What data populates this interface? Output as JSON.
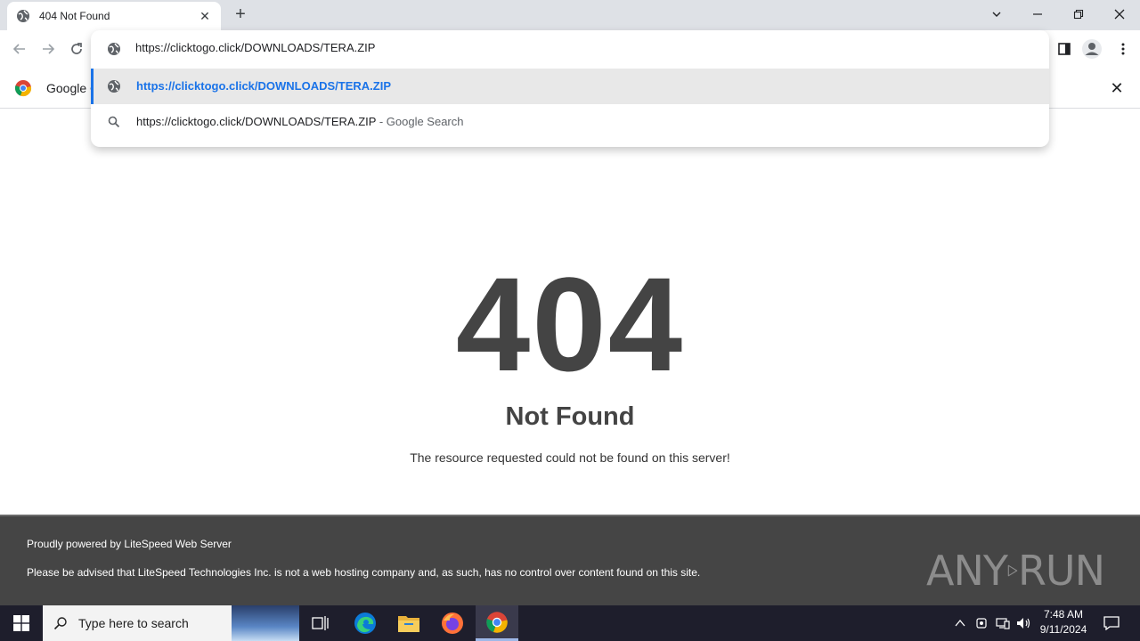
{
  "browser": {
    "tab": {
      "title": "404 Not Found"
    },
    "omnibox": {
      "input_value": "https://clicktogo.click/DOWNLOADS/TERA.ZIP",
      "suggestions": [
        {
          "text": "https://clicktogo.click/DOWNLOADS/TERA.ZIP",
          "suffix": ""
        },
        {
          "text": "https://clicktogo.click/DOWNLOADS/TERA.ZIP",
          "suffix": " - Google Search"
        }
      ]
    },
    "infobar": {
      "text": "Google C"
    },
    "accent_color": "#1a73e8"
  },
  "page": {
    "error_code": "404",
    "title": "Not Found",
    "description": "The resource requested could not be found on this server!",
    "footer": {
      "line1": "Proudly powered by LiteSpeed Web Server",
      "line2": "Please be advised that LiteSpeed Technologies Inc. is not a web hosting company and, as such, has no control over content found on this site."
    },
    "watermark": {
      "left": "ANY",
      "right": "RUN"
    }
  },
  "taskbar": {
    "search_placeholder": "Type here to search",
    "clock": {
      "time": "7:48 AM",
      "date": "9/11/2024"
    }
  }
}
